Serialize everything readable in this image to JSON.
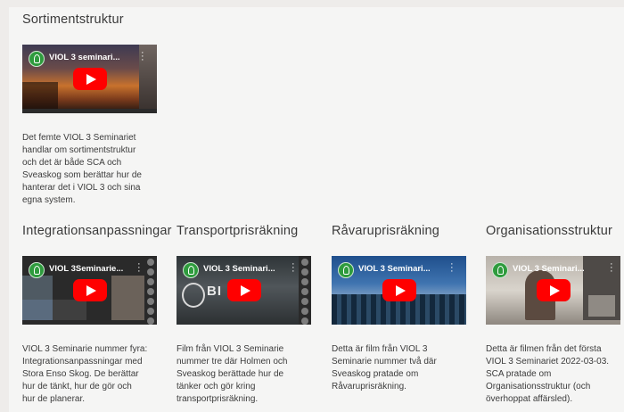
{
  "sections": [
    {
      "title": "Sortimentstruktur",
      "video_title": "VIOL 3 seminari...",
      "description_lines": [
        "Det femte VIOL 3 Seminariet",
        "handlar om sortimentstruktur",
        "och det är både SCA och",
        "Sveaskog som berättar hur de",
        "hanterar det i VIOL 3 och sina",
        "egna system."
      ]
    },
    {
      "title": "Integrationsanpassningar",
      "video_title": "VIOL 3Seminarie...",
      "description_lines": [
        "VIOL 3 Seminarie nummer fyra:",
        "Integrationsanpassningar med",
        "Stora Enso Skog. De berättar",
        "hur de tänkt, hur de gör och",
        "hur de planerar."
      ]
    },
    {
      "title": "Transportprisräkning",
      "video_title": "VIOL 3 Seminari...",
      "video_overlay": "BI",
      "description_lines": [
        "Film från VIOL 3 Seminarie",
        "nummer tre där Holmen och",
        "Sveaskog berättade hur de",
        "tänker och gör kring",
        "transportprisräkning."
      ]
    },
    {
      "title": "Råvaruprisräkning",
      "video_title": "VIOL 3 Seminari...",
      "description_lines": [
        "Detta är film från VIOL 3",
        "Seminarie nummer två där",
        "Sveaskog pratade om",
        "Råvaruprisräkning."
      ]
    },
    {
      "title": "Organisationsstruktur",
      "video_title": "VIOL 3 Seminari...",
      "description_lines": [
        "Detta är filmen från det första",
        "VIOL 3 Seminariet 2022-03-03.",
        "SCA pratade om",
        "Organisationsstruktur (och",
        "överhoppat affärsled)."
      ]
    }
  ],
  "colors": {
    "play_button": "#ff0000",
    "logo": "#2e9b3d",
    "text": "#3c3c3c",
    "background": "#f5f5f4"
  },
  "icons": {
    "play": "youtube-play-icon",
    "menu": "more-vert-icon",
    "logo": "channel-logo-icon"
  }
}
